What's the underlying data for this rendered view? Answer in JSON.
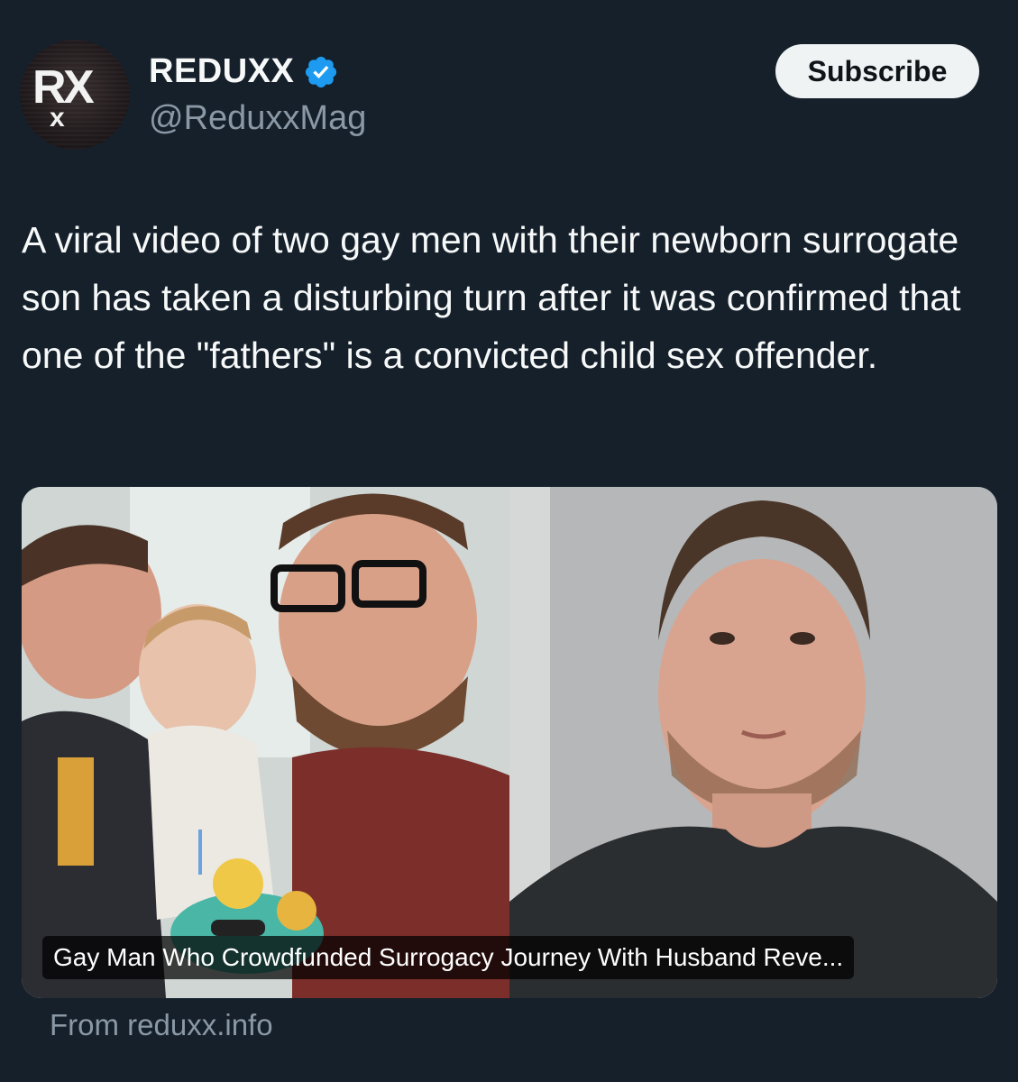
{
  "author": {
    "display_name": "REDUXX",
    "handle": "@ReduxxMag",
    "verified": true,
    "avatar_text": "RxX"
  },
  "actions": {
    "subscribe_label": "Subscribe"
  },
  "tweet": {
    "text": "A viral video of two gay men with their newborn surrogate son has taken a disturbing turn after it was confirmed that one of the \"fathers\" is a convicted child sex offender."
  },
  "card": {
    "caption": "Gay Man Who Crowdfunded Surrogacy Journey With Husband Reve...",
    "source": "From reduxx.info"
  },
  "colors": {
    "background": "#15202b",
    "verified_blue": "#1d9bf0",
    "secondary_text": "#8b98a5",
    "button_bg": "#eff3f4"
  },
  "icons": [
    "verified-badge-icon"
  ]
}
